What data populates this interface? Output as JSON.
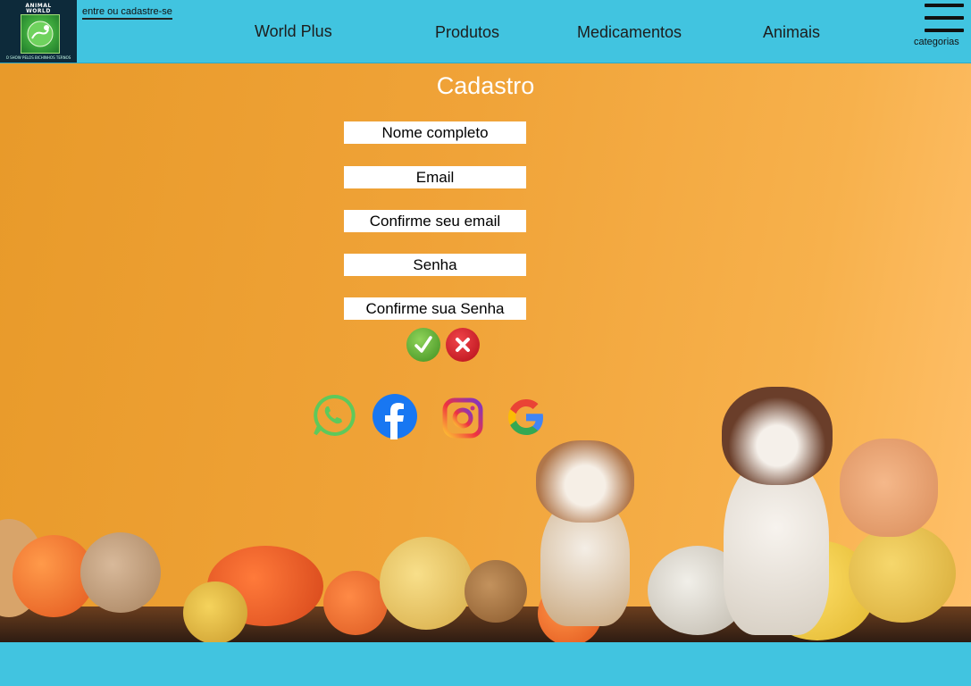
{
  "header": {
    "logo": {
      "brand_line1": "ANIMAL",
      "brand_line2": "WORLD",
      "tagline": "O SHOW PELOS BICHINHOS TERNOS",
      "icon": "animal-world-logo"
    },
    "login_link": "entre ou cadastre-se",
    "nav": [
      "World Plus",
      "Produtos",
      "Medicamentos",
      "Animais"
    ],
    "menu_label": "categorias",
    "menu_icon": "hamburger-menu-icon"
  },
  "form": {
    "title": "Cadastro",
    "fields": [
      {
        "placeholder": "Nome completo"
      },
      {
        "placeholder": "Email"
      },
      {
        "placeholder": "Confirme seu email"
      },
      {
        "placeholder": "Senha"
      },
      {
        "placeholder": "Confirme sua Senha"
      }
    ],
    "confirm_icon": "checkmark-icon",
    "cancel_icon": "x-icon"
  },
  "social": [
    "whatsapp-icon",
    "facebook-icon",
    "instagram-icon",
    "google-icon"
  ],
  "colors": {
    "header_bg": "#41c4e0",
    "hero_bg": "#f0a338",
    "confirm": "#4c9a2a",
    "cancel": "#c8141e",
    "whatsapp": "#5ec95b",
    "facebook": "#1877f2"
  }
}
